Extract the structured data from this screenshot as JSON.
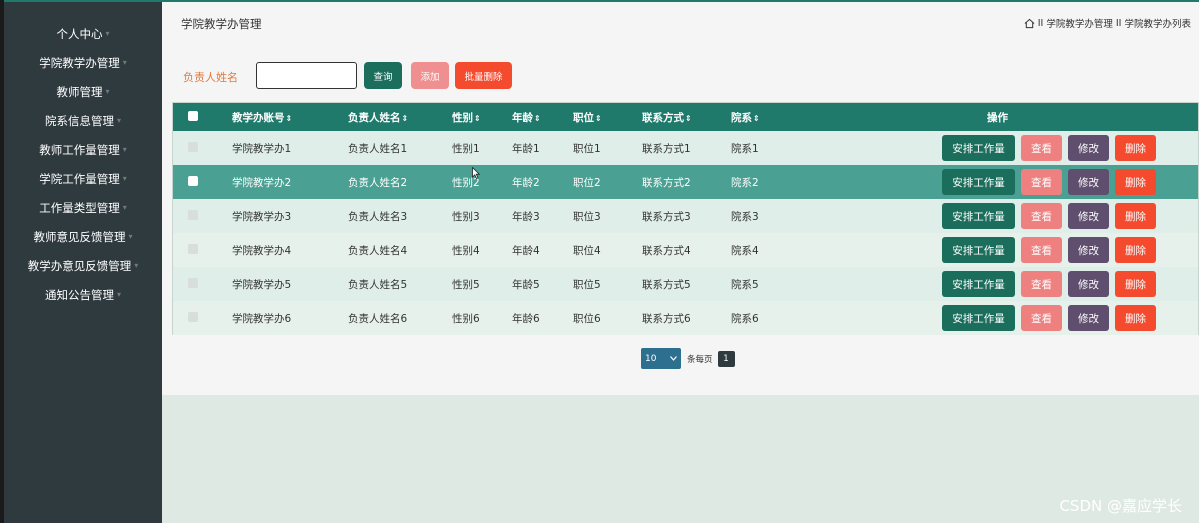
{
  "sidebar": {
    "items": [
      {
        "label": "个人中心"
      },
      {
        "label": "学院教学办管理"
      },
      {
        "label": "教师管理"
      },
      {
        "label": "院系信息管理"
      },
      {
        "label": "教师工作量管理"
      },
      {
        "label": "学院工作量管理"
      },
      {
        "label": "工作量类型管理"
      },
      {
        "label": "教师意见反馈管理"
      },
      {
        "label": "教学办意见反馈管理"
      },
      {
        "label": "通知公告管理"
      }
    ]
  },
  "header": {
    "title": "学院教学办管理",
    "breadcrumb": [
      "学院教学办管理",
      "学院教学办列表"
    ],
    "separator": "II"
  },
  "search": {
    "label": "负责人姓名",
    "value": "",
    "query_label": "查询",
    "add_label": "添加",
    "batch_delete_label": "批量删除"
  },
  "table": {
    "columns": [
      "教学办账号",
      "负责人姓名",
      "性别",
      "年龄",
      "职位",
      "联系方式",
      "院系"
    ],
    "ops_header": "操作",
    "sort_glyph": "⇕",
    "rows": [
      [
        "学院教学办1",
        "负责人姓名1",
        "性别1",
        "年龄1",
        "职位1",
        "联系方式1",
        "院系1"
      ],
      [
        "学院教学办2",
        "负责人姓名2",
        "性别2",
        "年龄2",
        "职位2",
        "联系方式2",
        "院系2"
      ],
      [
        "学院教学办3",
        "负责人姓名3",
        "性别3",
        "年龄3",
        "职位3",
        "联系方式3",
        "院系3"
      ],
      [
        "学院教学办4",
        "负责人姓名4",
        "性别4",
        "年龄4",
        "职位4",
        "联系方式4",
        "院系4"
      ],
      [
        "学院教学办5",
        "负责人姓名5",
        "性别5",
        "年龄5",
        "职位5",
        "联系方式5",
        "院系5"
      ],
      [
        "学院教学办6",
        "负责人姓名6",
        "性别6",
        "年龄6",
        "职位6",
        "联系方式6",
        "院系6"
      ]
    ],
    "highlighted_row": 1,
    "row_actions": {
      "assign": "安排工作量",
      "view": "查看",
      "edit": "修改",
      "delete": "删除"
    }
  },
  "pagination": {
    "page_size": "10",
    "per_page_label": "条每页",
    "current_page": "1"
  },
  "watermark": "CSDN @嘉应学长",
  "colors": {
    "primary": "#1f7a6c",
    "sidebar": "#2f3a3f",
    "add": "#ef8f8f",
    "delete": "#f44a2e",
    "edit": "#5f4e6e"
  },
  "icons": {
    "home": "home-icon",
    "caret": "caret-down-icon",
    "sort": "sort-icon",
    "select": "chevron-down-icon"
  }
}
